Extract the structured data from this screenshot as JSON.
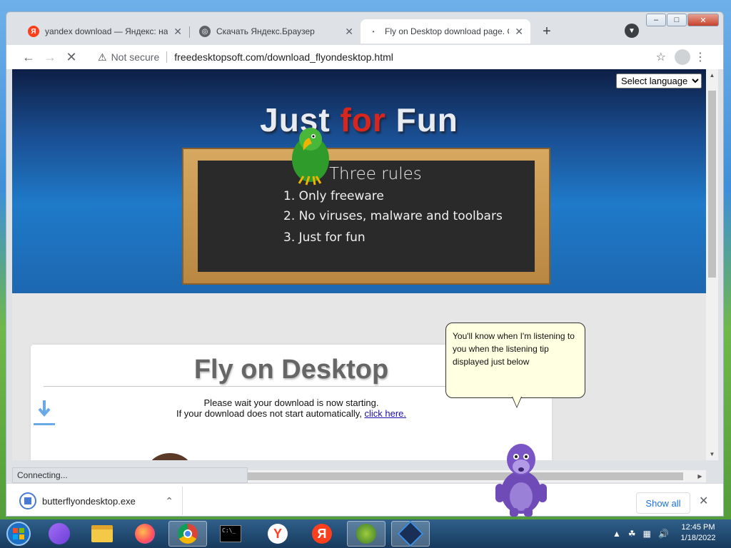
{
  "browser": {
    "tabs": [
      {
        "title": "yandex download — Яндекс: нашлось",
        "favicon": "yandex-favicon"
      },
      {
        "title": "Скачать Яндекс.Браузер",
        "favicon": "globe-favicon"
      },
      {
        "title": "Fly on Desktop download page. O",
        "favicon": "loading-favicon",
        "active": true
      }
    ],
    "security_label": "Not secure",
    "url": "freedesktopsoft.com/download_flyondesktop.html",
    "status_text": "Connecting..."
  },
  "page": {
    "language_select": "Select language",
    "hero": {
      "title_part1": "Just ",
      "title_accent": "for",
      "title_part2": " Fun"
    },
    "board": {
      "title": "Three rules",
      "rules": [
        "1. Only freeware",
        "2. No viruses, malware and toolbars",
        "3. Just for fun"
      ]
    },
    "card": {
      "title": "Fly on Desktop",
      "message_line1": "Please wait your download is now starting.",
      "message_line2": "If your download does not start automatically, ",
      "link_text": "click here."
    },
    "tooltip": "You'll know when I'm listening to you when the listening tip displayed just below"
  },
  "download_bar": {
    "filename": "butterflyondesktop.exe",
    "show_all": "Show all"
  },
  "taskbar": {
    "time": "12:45 PM",
    "date": "1/18/2022"
  },
  "colors": {
    "accent_red": "#d8251d",
    "link_blue": "#1a0dab",
    "yandex_red": "#fc3f1d"
  }
}
